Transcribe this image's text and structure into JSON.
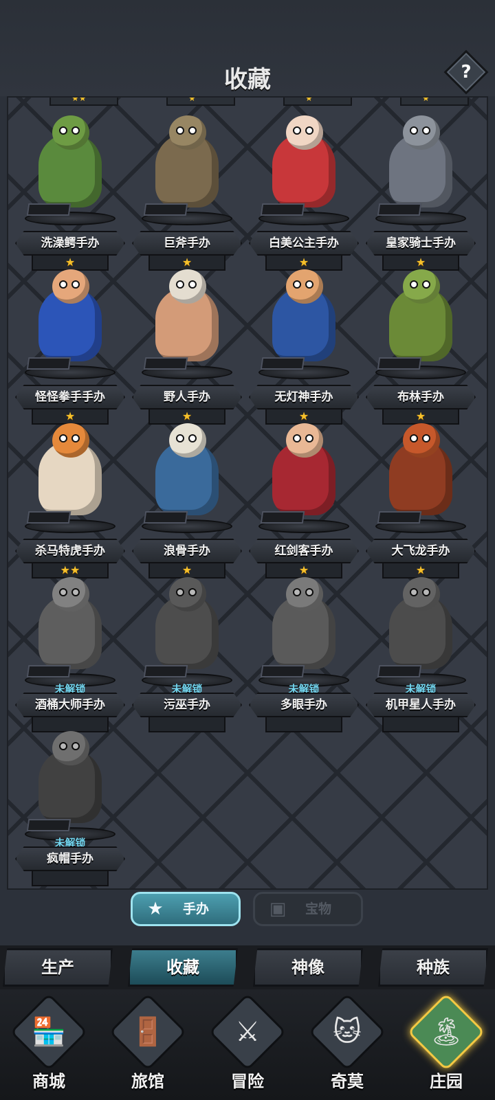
{
  "header": {
    "title": "收藏",
    "help_label": "?"
  },
  "figures": [
    {
      "name": "洗澡鳄手办",
      "stars": "★",
      "locked": false,
      "body": "#5a8a3d",
      "head": "#6e9c44"
    },
    {
      "name": "巨斧手办",
      "stars": "★",
      "locked": false,
      "body": "#7b6a4e",
      "head": "#978663"
    },
    {
      "name": "白美公主手办",
      "stars": "★",
      "locked": false,
      "body": "#c8373a",
      "head": "#f0d6c4"
    },
    {
      "name": "皇家骑士手办",
      "stars": "★",
      "locked": false,
      "body": "#6e7480",
      "head": "#8d939c"
    },
    {
      "name": "怪怪拳手手办",
      "stars": "★",
      "locked": false,
      "body": "#2c55b8",
      "head": "#e5a77b"
    },
    {
      "name": "野人手办",
      "stars": "★",
      "locked": false,
      "body": "#d39b78",
      "head": "#e4ddd0"
    },
    {
      "name": "无灯神手办",
      "stars": "★",
      "locked": false,
      "body": "#2d56a3",
      "head": "#e3a46f"
    },
    {
      "name": "布林手办",
      "stars": "★",
      "locked": false,
      "body": "#6b8a37",
      "head": "#86a94a"
    },
    {
      "name": "杀马特虎手办",
      "stars": "★★",
      "locked": false,
      "body": "#e6d7c2",
      "head": "#e5893b"
    },
    {
      "name": "浪骨手办",
      "stars": "★",
      "locked": false,
      "body": "#3a6a9b",
      "head": "#e7e2d4"
    },
    {
      "name": "红剑客手办",
      "stars": "★",
      "locked": false,
      "body": "#a72832",
      "head": "#e9b895"
    },
    {
      "name": "大飞龙手办",
      "stars": "★",
      "locked": false,
      "body": "#8f3c22",
      "head": "#c6582b"
    },
    {
      "name": "酒桶大师手办",
      "stars": "",
      "locked": true,
      "lock_label": "未解锁",
      "body": "#6f6f6f",
      "head": "#b3b3b3"
    },
    {
      "name": "污巫手办",
      "stars": "",
      "locked": true,
      "lock_label": "未解锁",
      "body": "#5b5b5b",
      "head": "#7c7c7c"
    },
    {
      "name": "多眼手办",
      "stars": "",
      "locked": true,
      "lock_label": "未解锁",
      "body": "#6a6a6a",
      "head": "#a8a8a8"
    },
    {
      "name": "机甲星人手办",
      "stars": "",
      "locked": true,
      "lock_label": "未解锁",
      "body": "#595959",
      "head": "#8a8a8a"
    },
    {
      "name": "疯帽手办",
      "stars": "",
      "locked": true,
      "lock_label": "未解锁",
      "body": "#4d4d4d",
      "head": "#9a9a9a"
    }
  ],
  "top_partial_stars": [
    "★★",
    "★",
    "★",
    "★"
  ],
  "subtabs": {
    "figures": "手办",
    "treasure": "宝物",
    "figures_icon": "★",
    "treasure_icon": "▣"
  },
  "section_tabs": [
    "生产",
    "收藏",
    "神像",
    "种族"
  ],
  "bottom_nav": [
    {
      "label": "商城",
      "icon": "🏪"
    },
    {
      "label": "旅馆",
      "icon": "🚪"
    },
    {
      "label": "冒险",
      "icon": "⚔"
    },
    {
      "label": "奇莫",
      "icon": "🐱"
    },
    {
      "label": "庄园",
      "icon": "🏝"
    }
  ]
}
